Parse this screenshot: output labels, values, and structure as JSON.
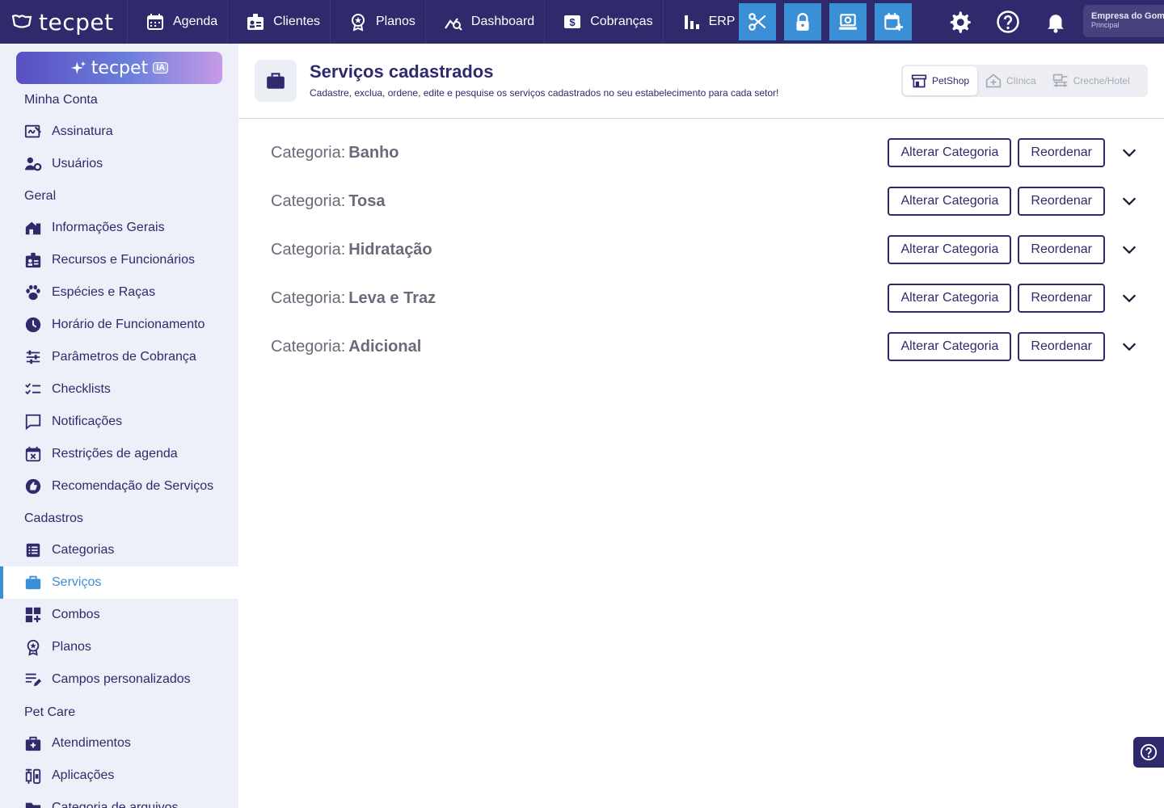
{
  "topbar": {
    "logo": "tecpet",
    "nav": [
      {
        "label": "Agenda",
        "icon": "calendar-icon"
      },
      {
        "label": "Clientes",
        "icon": "client-card-icon"
      },
      {
        "label": "Planos",
        "icon": "medal-icon"
      },
      {
        "label": "Dashboard",
        "icon": "chart-search-icon"
      },
      {
        "label": "Cobranças",
        "icon": "dollar-icon"
      },
      {
        "label": "ERP",
        "icon": "bar-chart-icon"
      }
    ],
    "quick_actions": [
      "scissors-icon",
      "lock-icon",
      "register-icon",
      "calendar-add-icon"
    ],
    "right_icons": [
      "gear-icon",
      "help-icon",
      "bell-icon"
    ],
    "company_name": "Empresa do Gomes",
    "company_unit": "Principal",
    "accent": "#3b8fd6",
    "brand": "#2e2a6b"
  },
  "sidebar": {
    "ia_button": {
      "label": "tecpet",
      "badge": "IA"
    },
    "sections": [
      {
        "title": "Minha Conta",
        "items": [
          {
            "label": "Assinatura",
            "icon": "signature-icon"
          },
          {
            "label": "Usuários",
            "icon": "users-gear-icon"
          }
        ]
      },
      {
        "title": "Geral",
        "items": [
          {
            "label": "Informações Gerais",
            "icon": "store-icon"
          },
          {
            "label": "Recursos e Funcionários",
            "icon": "badge-icon"
          },
          {
            "label": "Espécies e Raças",
            "icon": "paw-icon"
          },
          {
            "label": "Horário de Funcionamento",
            "icon": "clock-icon"
          },
          {
            "label": "Parâmetros de Cobrança",
            "icon": "sliders-icon"
          },
          {
            "label": "Checklists",
            "icon": "checklist-icon"
          },
          {
            "label": "Notificações",
            "icon": "message-icon"
          },
          {
            "label": "Restrições de agenda",
            "icon": "calendar-x-icon"
          },
          {
            "label": "Recomendação de Serviços",
            "icon": "thumb-icon"
          }
        ]
      },
      {
        "title": "Cadastros",
        "items": [
          {
            "label": "Categorias",
            "icon": "list-icon"
          },
          {
            "label": "Serviços",
            "icon": "briefcase-icon",
            "active": true
          },
          {
            "label": "Combos",
            "icon": "grid-plus-icon"
          },
          {
            "label": "Planos",
            "icon": "medal-icon"
          },
          {
            "label": "Campos personalizados",
            "icon": "edit-list-icon"
          }
        ]
      },
      {
        "title": "Pet Care",
        "items": [
          {
            "label": "Atendimentos",
            "icon": "medkit-icon"
          },
          {
            "label": "Aplicações",
            "icon": "syringe-icon"
          },
          {
            "label": "Categoria de arquivos",
            "icon": "folder-icon"
          }
        ]
      }
    ]
  },
  "main": {
    "title": "Serviços cadastrados",
    "subtitle": "Cadastre, exclua, ordene, edite e pesquise os serviços cadastrados no seu estabelecimento para cada setor!",
    "sectors": [
      {
        "label": "PetShop",
        "icon": "shop-icon",
        "active": true
      },
      {
        "label": "Clínica",
        "icon": "clinic-icon",
        "active": false
      },
      {
        "label": "Creche/Hotel",
        "icon": "hotel-icon",
        "active": false
      }
    ],
    "category_prefix": "Categoria:",
    "alter_label": "Alterar Categoria",
    "reorder_label": "Reordenar",
    "categories": [
      "Banho",
      "Tosa",
      "Hidratação",
      "Leva e Traz",
      "Adicional"
    ]
  }
}
